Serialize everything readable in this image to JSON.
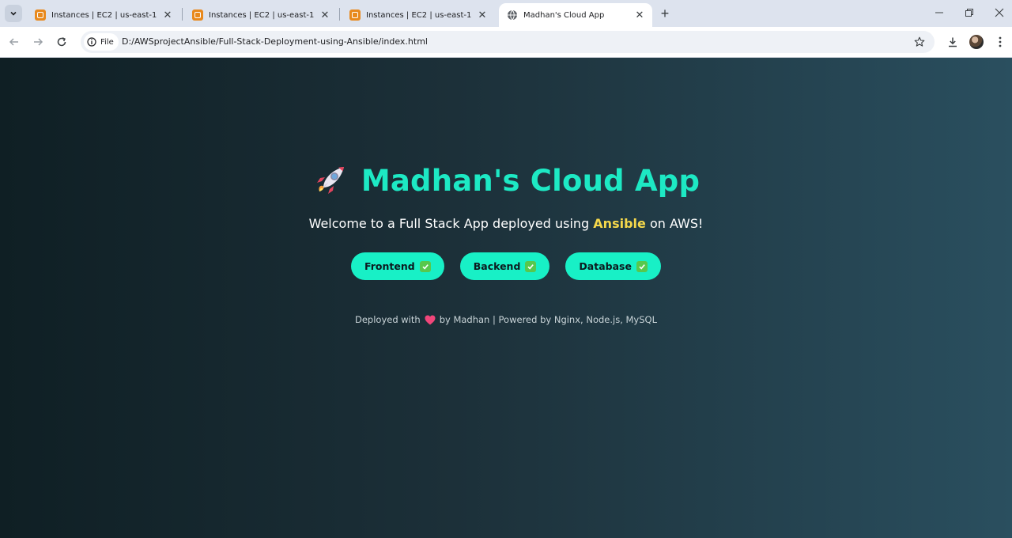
{
  "browser": {
    "tabs": [
      {
        "title": "Instances | EC2 | us-east-1",
        "favicon": "aws-ec2-icon"
      },
      {
        "title": "Instances | EC2 | us-east-1",
        "favicon": "aws-ec2-icon"
      },
      {
        "title": "Instances | EC2 | us-east-1",
        "favicon": "aws-ec2-icon"
      },
      {
        "title": "Madhan's Cloud App",
        "favicon": "globe-icon",
        "active": true
      }
    ],
    "new_tab_glyph": "+",
    "chip_label": "File",
    "url": "D:/AWSprojectAnsible/Full-Stack-Deployment-using-Ansible/index.html"
  },
  "page": {
    "title": "Madhan's Cloud App",
    "subtitle_prefix": "Welcome to a Full Stack App deployed using ",
    "subtitle_highlight": "Ansible",
    "subtitle_suffix": " on AWS!",
    "pills": [
      {
        "label": "Frontend"
      },
      {
        "label": "Backend"
      },
      {
        "label": "Database"
      }
    ],
    "footer_prefix": "Deployed with",
    "footer_suffix": "by Madhan | Powered by Nginx, Node.js, MySQL"
  },
  "colors": {
    "accent": "#1de9c4",
    "pill_bg": "#18f0c6",
    "highlight": "#f5d84b",
    "bg_dark": "#0f1f24",
    "bg_light": "#2a4f5f"
  }
}
